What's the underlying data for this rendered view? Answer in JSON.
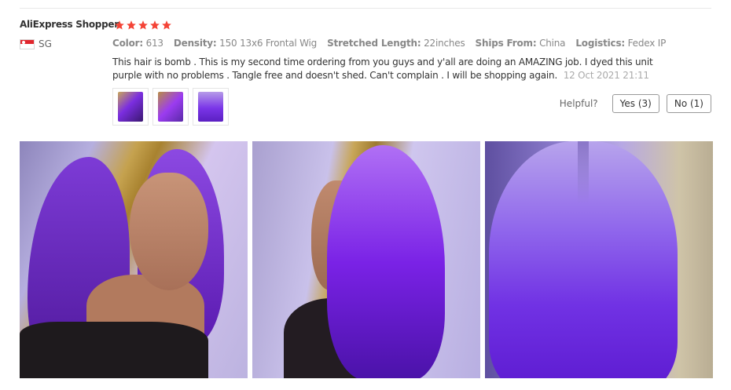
{
  "review": {
    "reviewer": "AliExpress Shopper",
    "rating": 5,
    "country": "SG",
    "attributes": [
      {
        "key": "Color:",
        "value": "613"
      },
      {
        "key": "Density:",
        "value": "150 13x6 Frontal Wig"
      },
      {
        "key": "Stretched Length:",
        "value": "22inches"
      },
      {
        "key": "Ships From:",
        "value": "China"
      },
      {
        "key": "Logistics:",
        "value": "Fedex IP"
      }
    ],
    "text_line1": "This hair is bomb . This is my second time ordering from you guys and y'all are doing an AMAZING job. I dyed this unit",
    "text_line2": "purple with no problems . Tangle free and doesn't shed. Can't complain . I will be shopping again.",
    "date": "12 Oct 2021 21:11",
    "thumbnail_count": 3
  },
  "helpful": {
    "label": "Helpful?",
    "yes_label": "Yes (3)",
    "no_label": "No (1)"
  },
  "colors": {
    "star": "#f44336",
    "divider": "#e8e8e8",
    "button_border": "#999999"
  },
  "icons": {
    "star": "star-icon",
    "flag": "singapore-flag-icon"
  }
}
